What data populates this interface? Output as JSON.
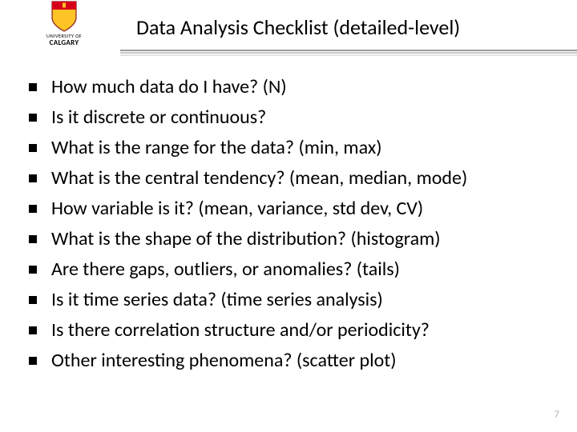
{
  "header": {
    "title": "Data Analysis Checklist (detailed-level)",
    "logo": {
      "line1": "UNIVERSITY OF",
      "line2": "CALGARY"
    }
  },
  "items": [
    "How much data do I have? (N)",
    "Is it discrete or continuous?",
    "What is the range for the data? (min, max)",
    "What is the central tendency? (mean, median, mode)",
    "How variable is it? (mean, variance, std dev, CV)",
    "What is the shape of the distribution? (histogram)",
    "Are there gaps, outliers, or anomalies? (tails)",
    "Is it time series data? (time series analysis)",
    "Is there correlation structure and/or periodicity?",
    "Other interesting phenomena? (scatter plot)"
  ],
  "footer": {
    "page_number": "7"
  }
}
